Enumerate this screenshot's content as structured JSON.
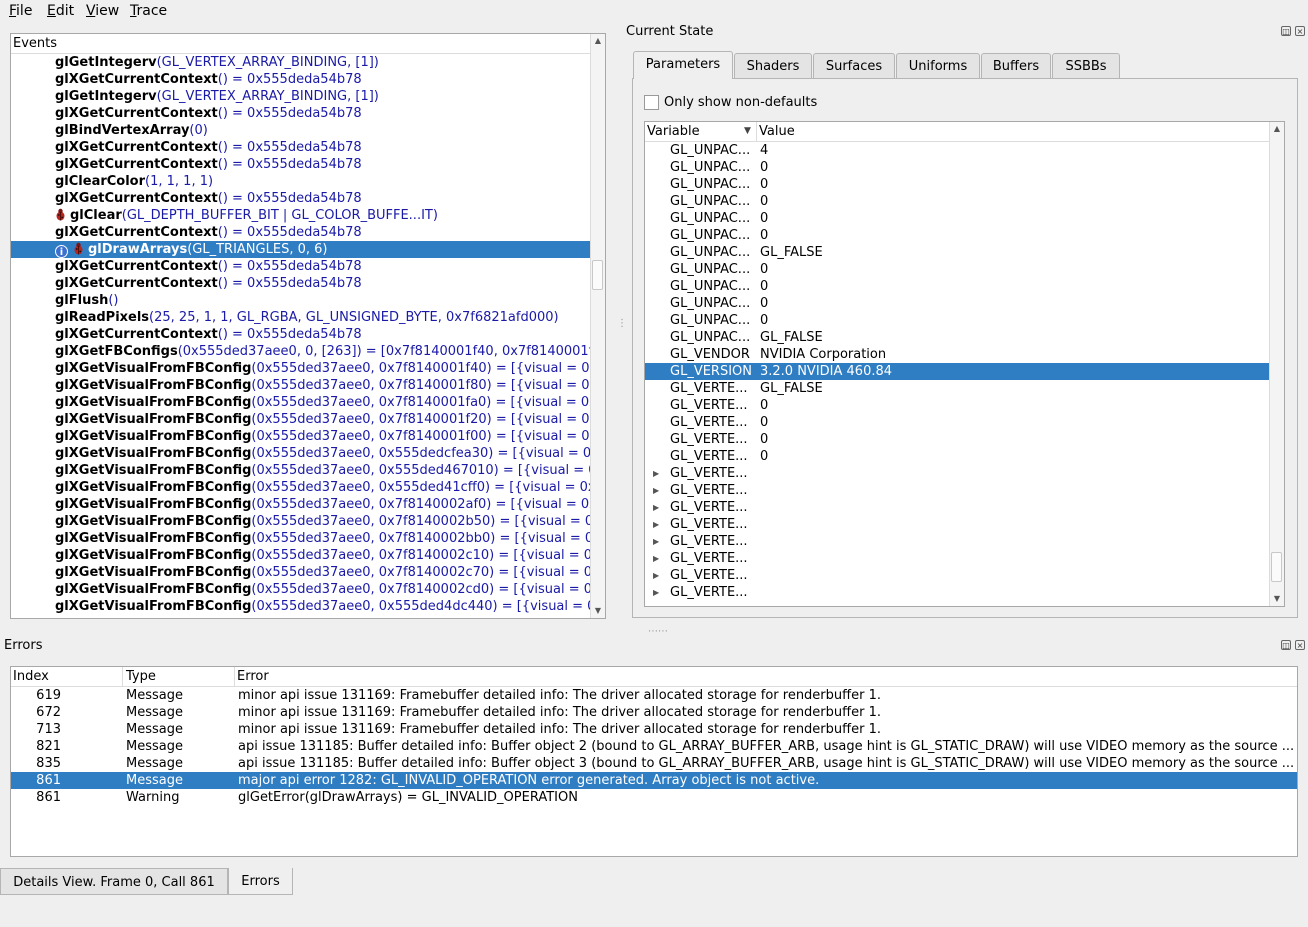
{
  "menu": [
    {
      "id": "file",
      "accel": "F",
      "rest": "ile"
    },
    {
      "id": "edit",
      "accel": "E",
      "rest": "dit"
    },
    {
      "id": "view",
      "accel": "V",
      "rest": "iew"
    },
    {
      "id": "trace",
      "accel": "T",
      "rest": "race"
    }
  ],
  "events": {
    "header": "Events",
    "rows": [
      {
        "fn": "glGetIntegerv",
        "args": "(GL_VERTEX_ARRAY_BINDING, [1])"
      },
      {
        "fn": "glXGetCurrentContext",
        "args": "() = 0x555deda54b78"
      },
      {
        "fn": "glGetIntegerv",
        "args": "(GL_VERTEX_ARRAY_BINDING, [1])"
      },
      {
        "fn": "glXGetCurrentContext",
        "args": "() = 0x555deda54b78"
      },
      {
        "fn": "glBindVertexArray",
        "args": "(0)"
      },
      {
        "fn": "glXGetCurrentContext",
        "args": "() = 0x555deda54b78"
      },
      {
        "fn": "glXGetCurrentContext",
        "args": "() = 0x555deda54b78"
      },
      {
        "fn": "glClearColor",
        "args": "(1, 1, 1, 1)"
      },
      {
        "fn": "glXGetCurrentContext",
        "args": "() = 0x555deda54b78"
      },
      {
        "fn": "glClear",
        "args": "(GL_DEPTH_BUFFER_BIT | GL_COLOR_BUFFE...IT)",
        "bug": true
      },
      {
        "fn": "glXGetCurrentContext",
        "args": "() = 0x555deda54b78"
      },
      {
        "fn": "glDrawArrays",
        "args": "(GL_TRIANGLES, 0, 6)",
        "bug": true,
        "info": true,
        "selected": true
      },
      {
        "fn": "glXGetCurrentContext",
        "args": "() = 0x555deda54b78"
      },
      {
        "fn": "glXGetCurrentContext",
        "args": "() = 0x555deda54b78"
      },
      {
        "fn": "glFlush",
        "args": "()"
      },
      {
        "fn": "glReadPixels",
        "args": "(25, 25, 1, 1, GL_RGBA, GL_UNSIGNED_BYTE, 0x7f6821afd000)"
      },
      {
        "fn": "glXGetCurrentContext",
        "args": "() = 0x555deda54b78"
      },
      {
        "fn": "glXGetFBConfigs",
        "args": "(0x555ded37aee0, 0, [263]) = [0x7f8140001f40, 0x7f8140001f"
      },
      {
        "fn": "glXGetVisualFromFBConfig",
        "args": "(0x555ded37aee0, 0x7f8140001f40) = [{visual = 0x"
      },
      {
        "fn": "glXGetVisualFromFBConfig",
        "args": "(0x555ded37aee0, 0x7f8140001f80) = [{visual = 0x"
      },
      {
        "fn": "glXGetVisualFromFBConfig",
        "args": "(0x555ded37aee0, 0x7f8140001fa0) = [{visual = 0x"
      },
      {
        "fn": "glXGetVisualFromFBConfig",
        "args": "(0x555ded37aee0, 0x7f8140001f20) = [{visual = 0x"
      },
      {
        "fn": "glXGetVisualFromFBConfig",
        "args": "(0x555ded37aee0, 0x7f8140001f00) = [{visual = 0x"
      },
      {
        "fn": "glXGetVisualFromFBConfig",
        "args": "(0x555ded37aee0, 0x555dedcfea30) = [{visual = 0x"
      },
      {
        "fn": "glXGetVisualFromFBConfig",
        "args": "(0x555ded37aee0, 0x555ded467010) = [{visual = 0x"
      },
      {
        "fn": "glXGetVisualFromFBConfig",
        "args": "(0x555ded37aee0, 0x555ded41cff0) = [{visual = 0x"
      },
      {
        "fn": "glXGetVisualFromFBConfig",
        "args": "(0x555ded37aee0, 0x7f8140002af0) = [{visual = 0x"
      },
      {
        "fn": "glXGetVisualFromFBConfig",
        "args": "(0x555ded37aee0, 0x7f8140002b50) = [{visual = 0x"
      },
      {
        "fn": "glXGetVisualFromFBConfig",
        "args": "(0x555ded37aee0, 0x7f8140002bb0) = [{visual = 0x"
      },
      {
        "fn": "glXGetVisualFromFBConfig",
        "args": "(0x555ded37aee0, 0x7f8140002c10) = [{visual = 0x"
      },
      {
        "fn": "glXGetVisualFromFBConfig",
        "args": "(0x555ded37aee0, 0x7f8140002c70) = [{visual = 0x"
      },
      {
        "fn": "glXGetVisualFromFBConfig",
        "args": "(0x555ded37aee0, 0x7f8140002cd0) = [{visual = 0x"
      },
      {
        "fn": "glXGetVisualFromFBConfig",
        "args": "(0x555ded37aee0, 0x555ded4dc440) = [{visual = 0x"
      }
    ]
  },
  "current_state": {
    "title": "Current State",
    "tabs": [
      {
        "label": "Parameters",
        "active": true
      },
      {
        "label": "Shaders"
      },
      {
        "label": "Surfaces"
      },
      {
        "label": "Uniforms"
      },
      {
        "label": "Buffers"
      },
      {
        "label": "SSBBs"
      }
    ],
    "only_non_defaults_label": "Only show non-defaults",
    "columns": {
      "variable": "Variable",
      "value": "Value"
    },
    "rows": [
      {
        "var": "GL_UNPAC...",
        "val": "4"
      },
      {
        "var": "GL_UNPAC...",
        "val": "0"
      },
      {
        "var": "GL_UNPAC...",
        "val": "0"
      },
      {
        "var": "GL_UNPAC...",
        "val": "0"
      },
      {
        "var": "GL_UNPAC...",
        "val": "0"
      },
      {
        "var": "GL_UNPAC...",
        "val": "0"
      },
      {
        "var": "GL_UNPAC...",
        "val": "GL_FALSE"
      },
      {
        "var": "GL_UNPAC...",
        "val": "0"
      },
      {
        "var": "GL_UNPAC...",
        "val": "0"
      },
      {
        "var": "GL_UNPAC...",
        "val": "0"
      },
      {
        "var": "GL_UNPAC...",
        "val": "0"
      },
      {
        "var": "GL_UNPAC...",
        "val": "GL_FALSE"
      },
      {
        "var": "GL_VENDOR",
        "val": "NVIDIA Corporation"
      },
      {
        "var": "GL_VERSION",
        "val": "3.2.0 NVIDIA 460.84",
        "selected": true
      },
      {
        "var": "GL_VERTE...",
        "val": "GL_FALSE"
      },
      {
        "var": "GL_VERTE...",
        "val": "0"
      },
      {
        "var": "GL_VERTE...",
        "val": "0"
      },
      {
        "var": "GL_VERTE...",
        "val": "0"
      },
      {
        "var": "GL_VERTE...",
        "val": "0"
      },
      {
        "var": "GL_VERTE...",
        "val": "",
        "expandable": true
      },
      {
        "var": "GL_VERTE...",
        "val": "",
        "expandable": true
      },
      {
        "var": "GL_VERTE...",
        "val": "",
        "expandable": true
      },
      {
        "var": "GL_VERTE...",
        "val": "",
        "expandable": true
      },
      {
        "var": "GL_VERTE...",
        "val": "",
        "expandable": true
      },
      {
        "var": "GL_VERTE...",
        "val": "",
        "expandable": true
      },
      {
        "var": "GL_VERTE...",
        "val": "",
        "expandable": true
      },
      {
        "var": "GL_VERTE...",
        "val": "",
        "expandable": true
      }
    ]
  },
  "errors": {
    "title": "Errors",
    "columns": {
      "index": "Index",
      "type": "Type",
      "error": "Error"
    },
    "rows": [
      {
        "index": "619",
        "type": "Message",
        "error": "minor api issue 131169: Framebuffer detailed info: The driver allocated storage for renderbuffer 1."
      },
      {
        "index": "672",
        "type": "Message",
        "error": "minor api issue 131169: Framebuffer detailed info: The driver allocated storage for renderbuffer 1."
      },
      {
        "index": "713",
        "type": "Message",
        "error": "minor api issue 131169: Framebuffer detailed info: The driver allocated storage for renderbuffer 1."
      },
      {
        "index": "821",
        "type": "Message",
        "error": "api issue 131185: Buffer detailed info: Buffer object 2 (bound to GL_ARRAY_BUFFER_ARB, usage hint is GL_STATIC_DRAW) will use VIDEO memory as the source ..."
      },
      {
        "index": "835",
        "type": "Message",
        "error": "api issue 131185: Buffer detailed info: Buffer object 3 (bound to GL_ARRAY_BUFFER_ARB, usage hint is GL_STATIC_DRAW) will use VIDEO memory as the source ..."
      },
      {
        "index": "861",
        "type": "Message",
        "error": "major api error 1282: GL_INVALID_OPERATION error generated. Array object is not active.",
        "selected": true
      },
      {
        "index": "861",
        "type": "Warning",
        "error": "glGetError(glDrawArrays) = GL_INVALID_OPERATION"
      }
    ]
  },
  "bottom_tabs": [
    {
      "label": "Details View. Frame 0, Call 861"
    },
    {
      "label": "Errors",
      "active": true
    }
  ],
  "colors": {
    "selection": "#2f7dc2",
    "args": "#1a1aa6"
  },
  "icons": [
    "bug-icon",
    "info-icon",
    "float-icon",
    "close-icon",
    "scroll-up-icon",
    "scroll-down-icon",
    "sort-indicator-icon",
    "expand-arrow-icon"
  ]
}
